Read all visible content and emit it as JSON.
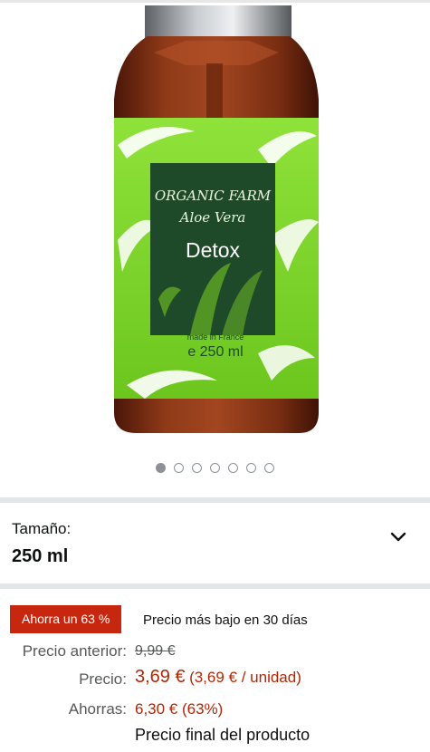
{
  "product": {
    "image_label": {
      "brand_line": "ORGANIC FARM",
      "sub_line": "Aloe Vera",
      "product_name": "Detox",
      "origin": "made in France",
      "volume": "e 250 ml"
    },
    "carousel": {
      "total": 7,
      "active_index": 0
    }
  },
  "size_selector": {
    "label": "Tamaño:",
    "value": "250 ml",
    "icon": "chevron-down-icon"
  },
  "pricing": {
    "discount_badge": "Ahorra un 63 %",
    "lowest_price_note": "Precio más bajo en 30 días",
    "previous_label": "Precio anterior:",
    "previous_value": "9,99 €",
    "price_label": "Precio:",
    "price_value": "3,69 €",
    "unit_price": "(3,69 € / unidad)",
    "savings_label": "Ahorras:",
    "savings_value": "6,30 € (63%)",
    "final_note": "Precio final del producto"
  },
  "colors": {
    "badge_red": "#c7270e",
    "price_red": "#b12704",
    "label_green": "#7ed321",
    "bottle_brown": "#8a3a1a"
  }
}
